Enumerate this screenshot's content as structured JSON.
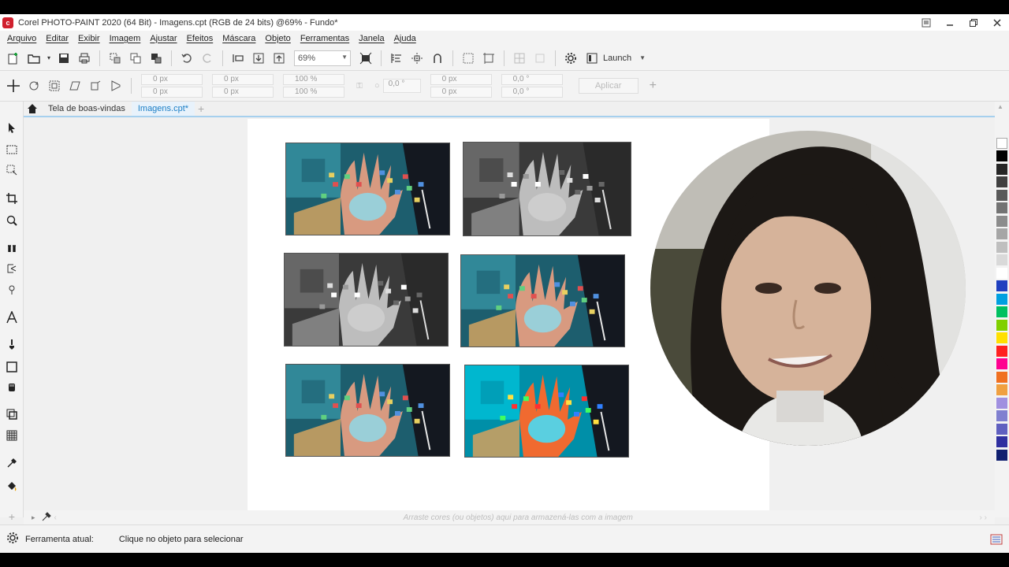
{
  "window": {
    "title": "Corel PHOTO-PAINT 2020 (64 Bit) - Imagens.cpt (RGB de 24 bits) @69% - Fundo*",
    "app_icon_letter": "c"
  },
  "menu": [
    "Arquivo",
    "Editar",
    "Exibir",
    "Imagem",
    "Ajustar",
    "Efeitos",
    "Máscara",
    "Objeto",
    "Ferramentas",
    "Janela",
    "Ajuda"
  ],
  "toolbar": {
    "zoom": "69%",
    "launch_label": "Launch"
  },
  "property_bar": {
    "x": "0 px",
    "y": "0 px",
    "w": "0 px",
    "h": "0 px",
    "scale_w": "100 %",
    "scale_h": "100 %",
    "angle": "0,0 °",
    "skew_x": "0 px",
    "skew_y": "0 px",
    "rot_x": "0,0 °",
    "rot_y": "0,0 °",
    "apply_label": "Aplicar"
  },
  "tabs": {
    "welcome": "Tela de boas-vindas",
    "document": "Imagens.cpt*"
  },
  "color_tray": {
    "hint": "Arraste cores (ou objetos) aqui para armazená-las com a imagem"
  },
  "status": {
    "label": "Ferramenta atual:",
    "message": "Clique no objeto para selecionar"
  },
  "images": {
    "variants": [
      "color",
      "grayscale",
      "grayscale",
      "color",
      "color",
      "saturated"
    ]
  },
  "palette_colors": [
    "#000000",
    "#262626",
    "#404040",
    "#595959",
    "#737373",
    "#8c8c8c",
    "#a6a6a6",
    "#bfbfbf",
    "#d9d9d9",
    "#ffffff",
    "#1f3fbf",
    "#00a0e0",
    "#00c060",
    "#80d000",
    "#ffe000",
    "#ff2020",
    "#ff0090",
    "#f07020",
    "#f0a040",
    "#a090e0",
    "#8080d0",
    "#6060c0",
    "#3030a0",
    "#102070"
  ]
}
